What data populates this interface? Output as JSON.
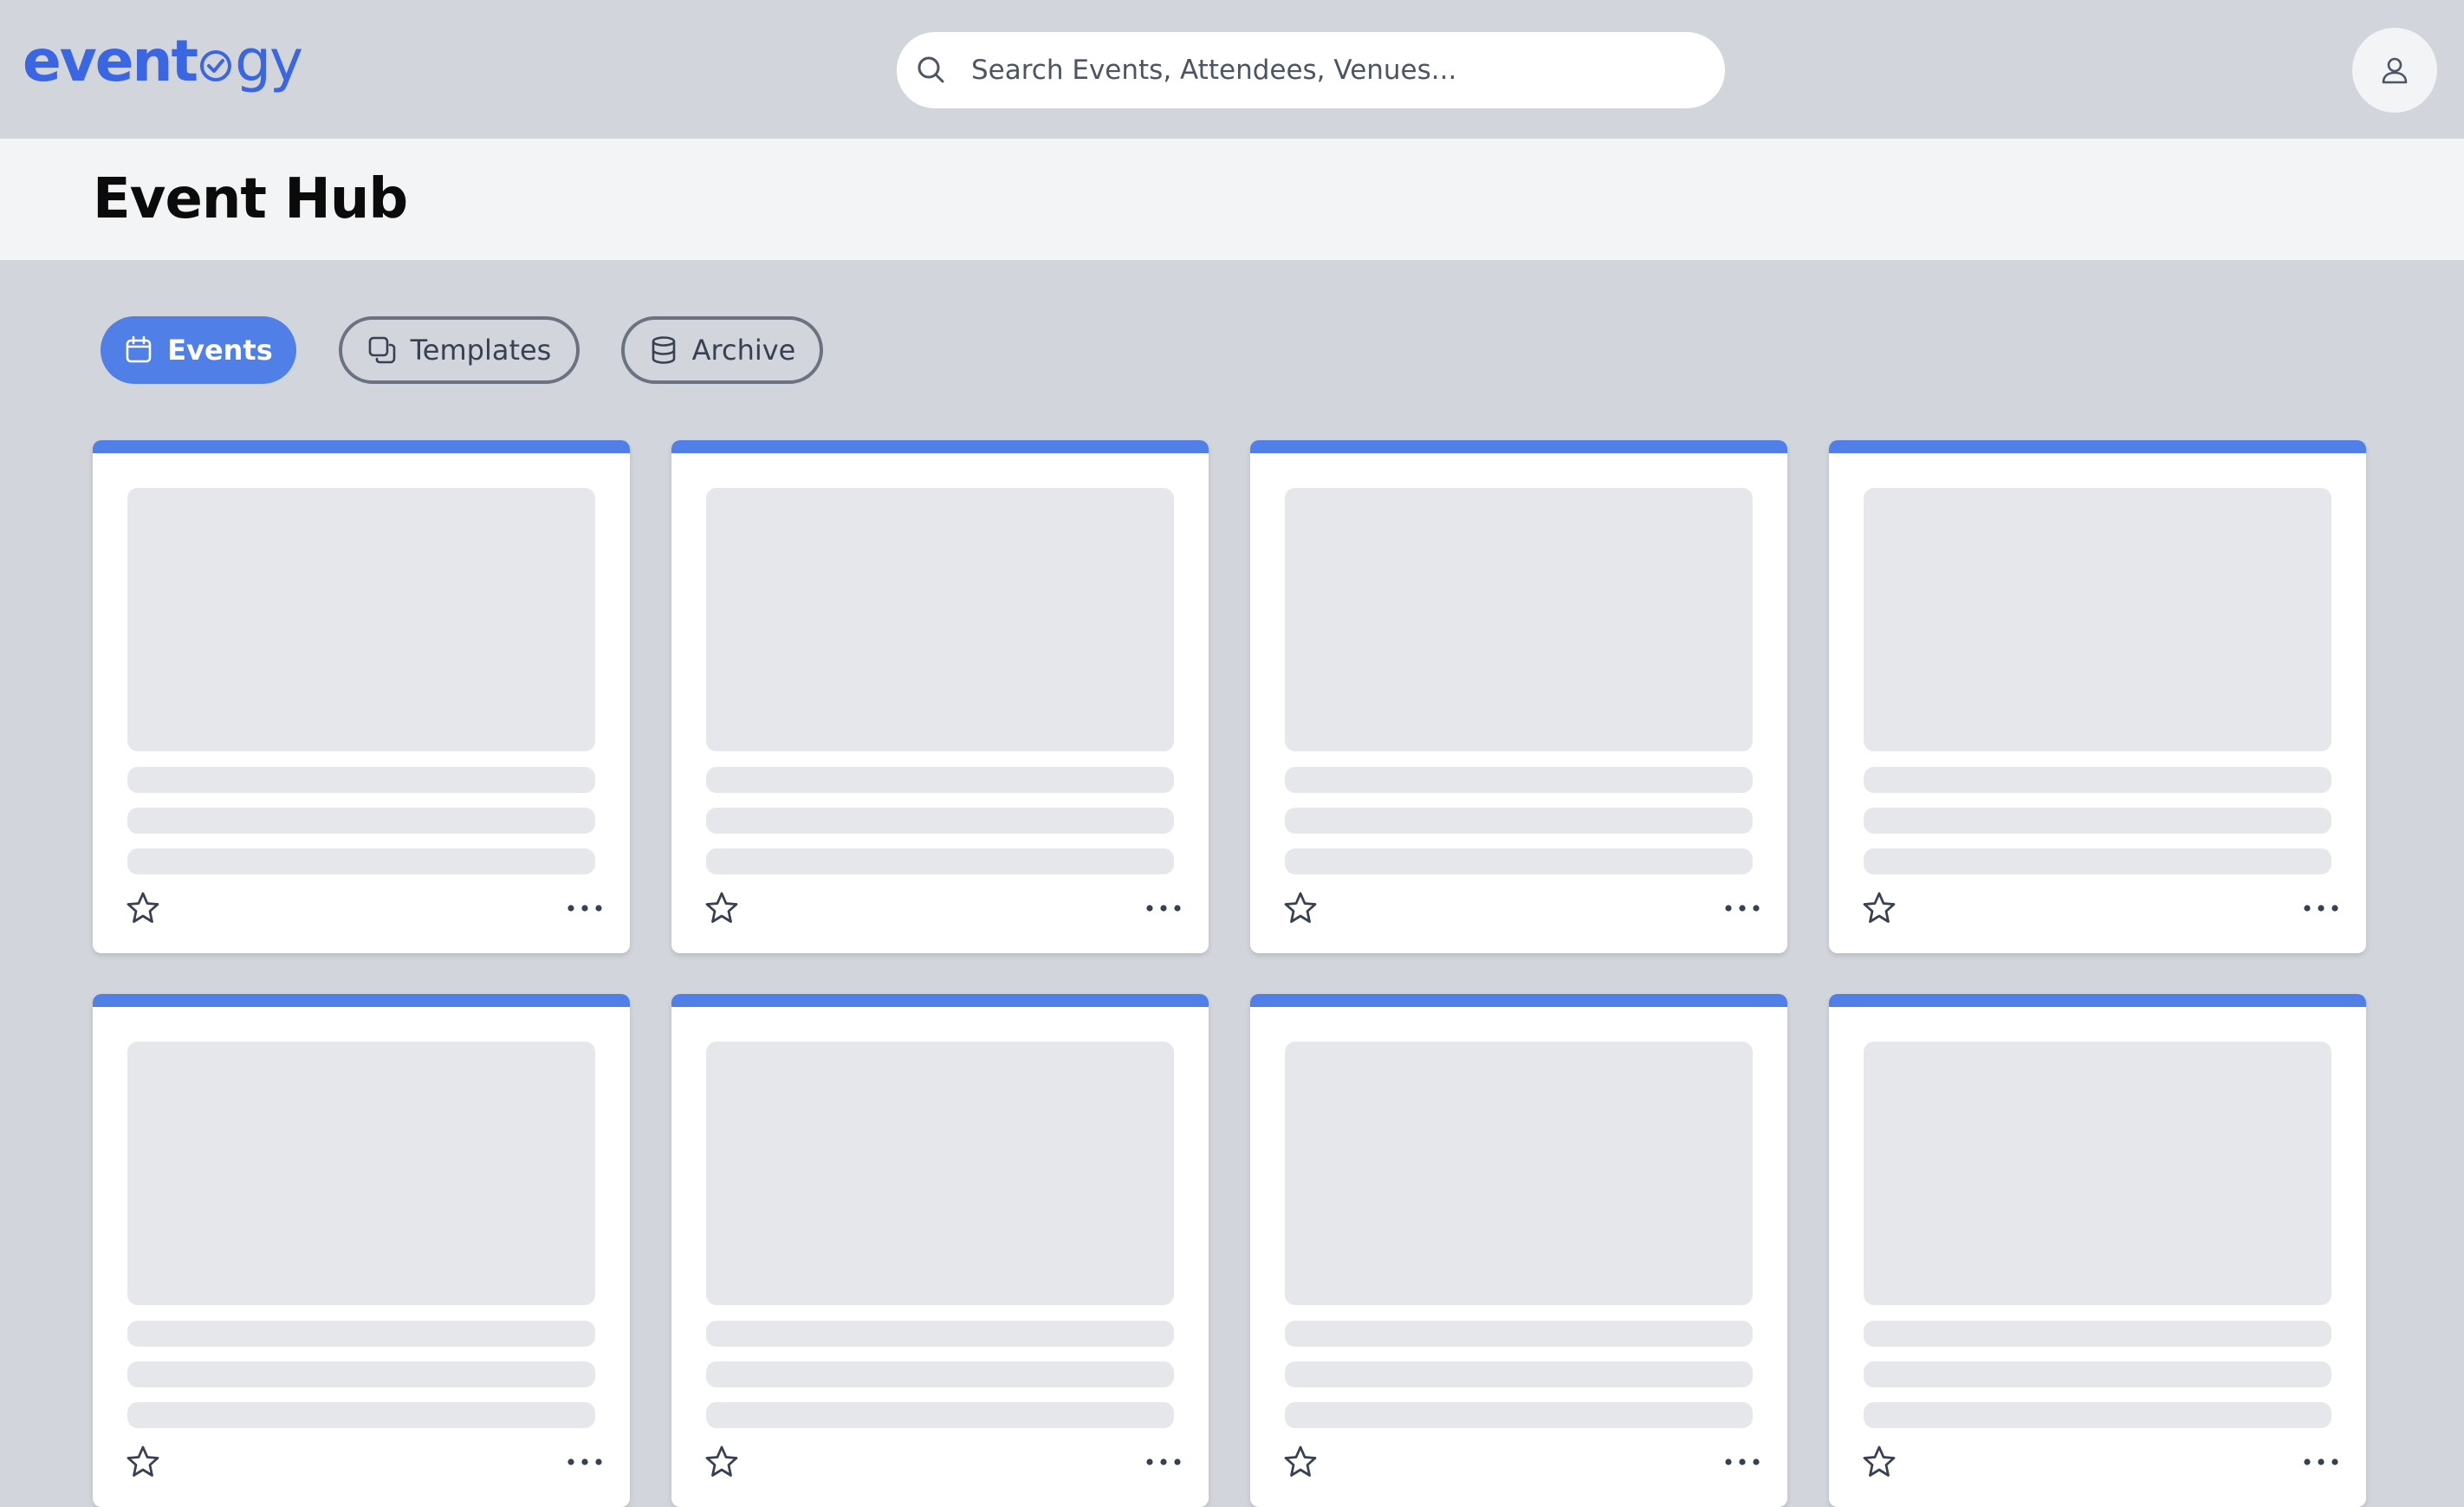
{
  "app": {
    "logo": {
      "part_bold": "event",
      "part_light": "gy"
    }
  },
  "header": {
    "search": {
      "placeholder": "Search Events, Attendees, Venues...",
      "value": ""
    }
  },
  "page": {
    "title": "Event Hub"
  },
  "tabs": [
    {
      "label": "Events",
      "icon": "calendar-icon",
      "active": true
    },
    {
      "label": "Templates",
      "icon": "copy-icon",
      "active": false
    },
    {
      "label": "Archive",
      "icon": "database-icon",
      "active": false
    }
  ],
  "cards": {
    "state": "loading",
    "count": 8,
    "actions": {
      "favorite_icon": "star-icon",
      "more_icon": "more-horizontal-icon"
    }
  },
  "colors": {
    "accent": "#4f7fe7",
    "logo": "#3b66e3",
    "background": "#d2d5db",
    "title_band": "#f3f4f6",
    "skeleton": "#e5e7eb"
  }
}
